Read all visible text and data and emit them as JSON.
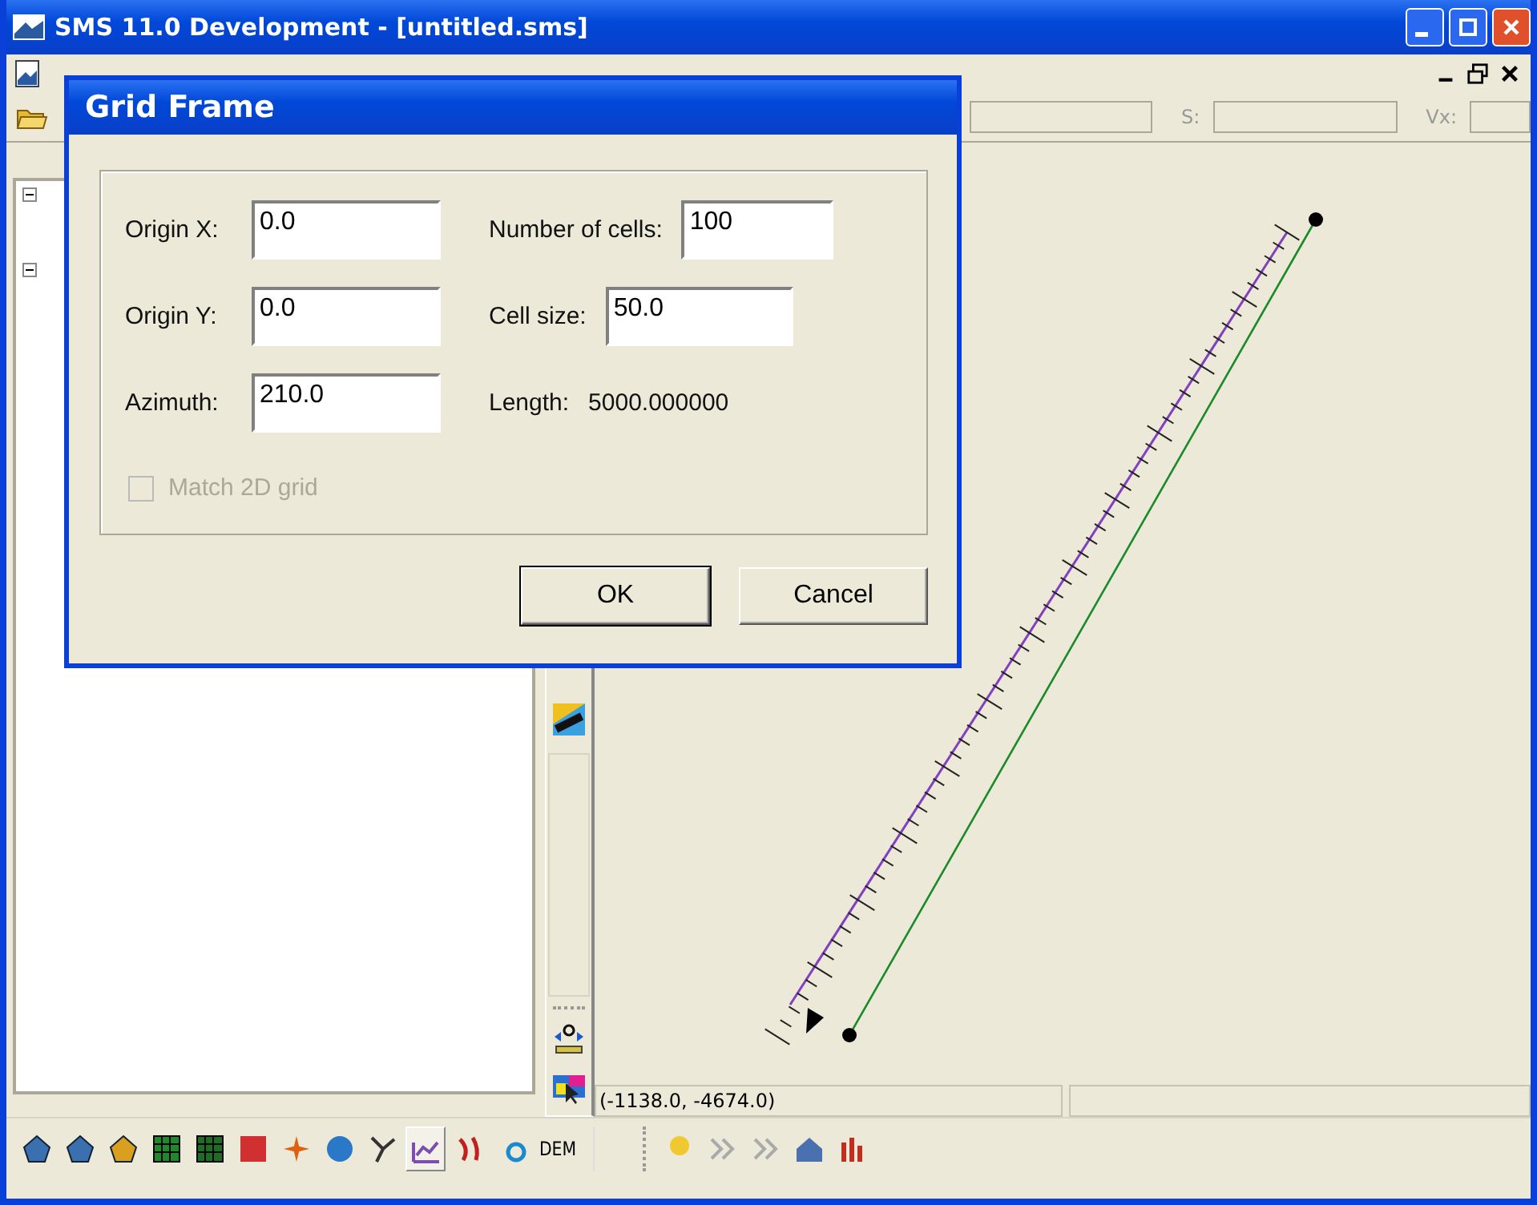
{
  "window": {
    "title": "SMS 11.0 Development - [untitled.sms]"
  },
  "toolbar_labels": [
    "S:",
    "Vx:"
  ],
  "tree": [
    {
      "expanded": true
    },
    {
      "expanded": true
    }
  ],
  "dialog": {
    "title": "Grid Frame",
    "left": [
      {
        "label": "Origin X:",
        "value": "0.0"
      },
      {
        "label": "Origin Y:",
        "value": "0.0"
      },
      {
        "label": "Azimuth:",
        "value": "210.0"
      }
    ],
    "right": [
      {
        "kind": "input",
        "label": "Number of cells:",
        "value": "100"
      },
      {
        "kind": "input",
        "label": "Cell size:",
        "value": "50.0"
      },
      {
        "kind": "text",
        "label": "Length:",
        "value": "5000.000000"
      }
    ],
    "checkbox": {
      "label": "Match 2D grid",
      "checked": false,
      "disabled": true
    },
    "buttons": [
      {
        "label": "OK",
        "default": true
      },
      {
        "label": "Cancel",
        "default": false
      }
    ]
  },
  "status": {
    "coordinates": "(-1138.0, -4674.0)"
  },
  "modules": [
    {
      "kind": "mesh",
      "selected": false
    },
    {
      "kind": "mesh",
      "selected": false
    },
    {
      "kind": "mesh2",
      "selected": false
    },
    {
      "kind": "grid",
      "selected": false
    },
    {
      "kind": "grid3",
      "selected": false
    },
    {
      "kind": "scatter",
      "selected": false
    },
    {
      "kind": "north",
      "selected": false
    },
    {
      "kind": "globe",
      "selected": false
    },
    {
      "kind": "network",
      "selected": false
    },
    {
      "kind": "chart",
      "selected": true
    },
    {
      "kind": "particles",
      "selected": false
    },
    {
      "kind": "tq",
      "selected": false
    },
    {
      "kind": "text",
      "label": "DEM",
      "selected": false
    }
  ],
  "tools": [
    {
      "kind": "bulb"
    },
    {
      "kind": "chevrons"
    },
    {
      "kind": "arrows"
    },
    {
      "kind": "house"
    },
    {
      "kind": "bars"
    }
  ]
}
